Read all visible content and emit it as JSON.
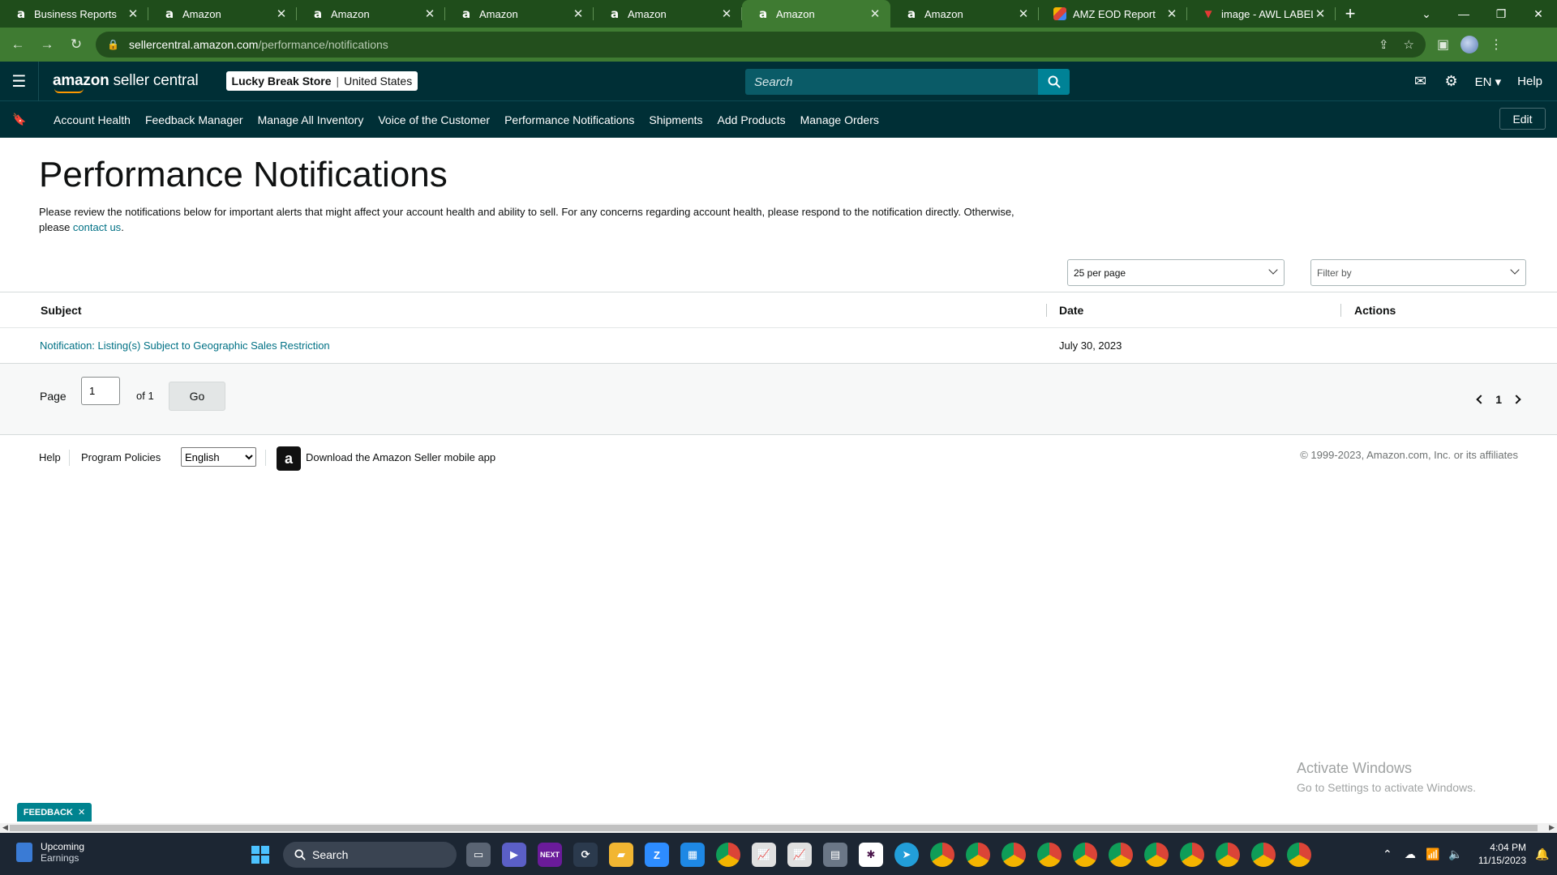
{
  "browser": {
    "tabs": [
      {
        "title": "Business Reports",
        "favicon": "a"
      },
      {
        "title": "Amazon",
        "favicon": "a"
      },
      {
        "title": "Amazon",
        "favicon": "a"
      },
      {
        "title": "Amazon",
        "favicon": "a"
      },
      {
        "title": "Amazon",
        "favicon": "a"
      },
      {
        "title": "Amazon",
        "favicon": "a",
        "active": true
      },
      {
        "title": "Amazon",
        "favicon": "a"
      },
      {
        "title": "AMZ EOD Report",
        "favicon": "chart"
      },
      {
        "title": "image - AWL LABEL",
        "favicon": "image"
      }
    ],
    "url_domain": "sellercentral.amazon.com",
    "url_path": "/performance/notifications",
    "theme_color": "#3f7b32"
  },
  "header": {
    "logo_bold": "amazon",
    "logo_rest": " seller central",
    "store_name": "Lucky Break Store",
    "store_region": "United States",
    "search_placeholder": "Search",
    "language": "EN",
    "help": "Help",
    "bg_color": "#002f36"
  },
  "nav": {
    "links": [
      "Account Health",
      "Feedback Manager",
      "Manage All Inventory",
      "Voice of the Customer",
      "Performance Notifications",
      "Shipments",
      "Add Products",
      "Manage Orders"
    ],
    "edit": "Edit"
  },
  "main": {
    "title": "Performance Notifications",
    "desc_before": "Please review the notifications below for important alerts that might affect your account health and ability to sell. For any concerns regarding account health, please respond to the notification directly. Otherwise, please ",
    "desc_link": "contact us",
    "desc_after": ".",
    "per_page": "25 per page",
    "filter_placeholder": "Filter by"
  },
  "table": {
    "headers": {
      "subject": "Subject",
      "date": "Date",
      "actions": "Actions"
    },
    "rows": [
      {
        "subject": "Notification: Listing(s) Subject to Geographic Sales Restriction",
        "date": "July 30, 2023",
        "actions": ""
      }
    ]
  },
  "pagination": {
    "page_label": "Page",
    "current": "1",
    "of_label": "of 1",
    "go": "Go",
    "page_number": "1"
  },
  "footer": {
    "help": "Help",
    "policies": "Program Policies",
    "language": "English",
    "app_text": "Download the Amazon Seller mobile app",
    "copyright": "© 1999-2023, Amazon.com, Inc. or its affiliates"
  },
  "watermark": {
    "line1": "Activate Windows",
    "line2": "Go to Settings to activate Windows."
  },
  "feedback": "FEEDBACK",
  "taskbar": {
    "weather_title": "Upcoming",
    "weather_sub": "Earnings",
    "search": "Search",
    "time": "4:04 PM",
    "date": "11/15/2023"
  }
}
